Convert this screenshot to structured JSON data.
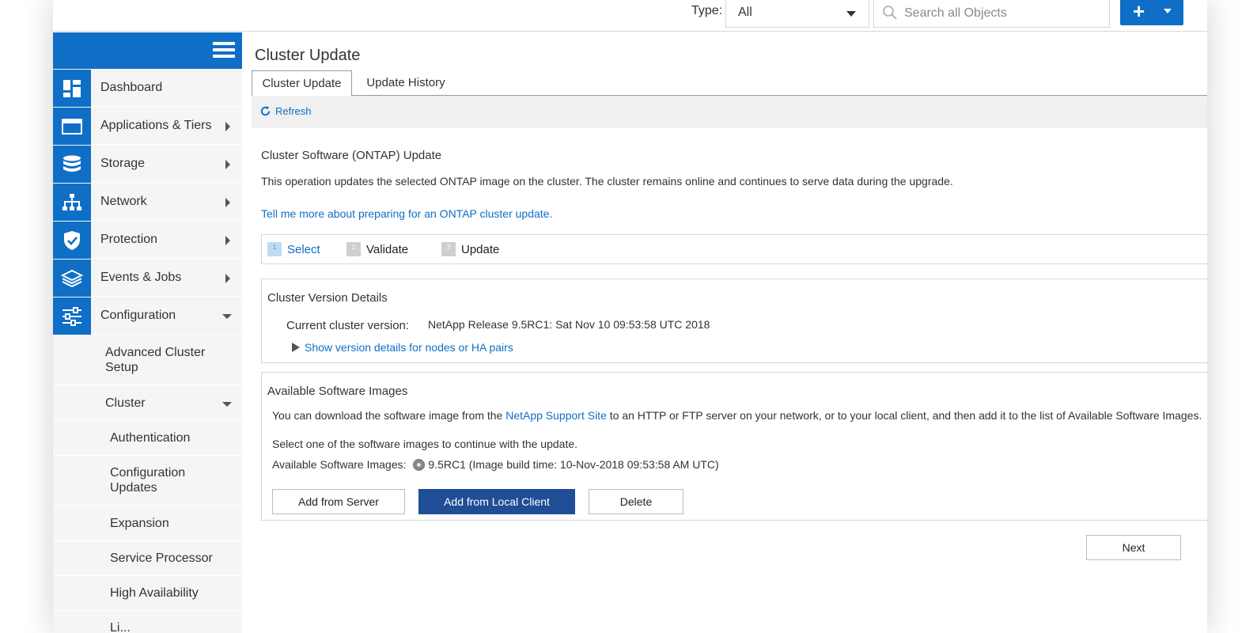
{
  "topbar": {
    "type_label": "Type:",
    "type_value": "All",
    "search_placeholder": "Search all Objects",
    "add_label": "+"
  },
  "sidebar": {
    "items": [
      {
        "label": "Dashboard",
        "icon": "dashboard-icon",
        "arrow": "none"
      },
      {
        "label": "Applications & Tiers",
        "icon": "applications-icon",
        "arrow": "right"
      },
      {
        "label": "Storage",
        "icon": "storage-icon",
        "arrow": "right"
      },
      {
        "label": "Network",
        "icon": "network-icon",
        "arrow": "right"
      },
      {
        "label": "Protection",
        "icon": "shield-check-icon",
        "arrow": "right"
      },
      {
        "label": "Events & Jobs",
        "icon": "layers-icon",
        "arrow": "right"
      },
      {
        "label": "Configuration",
        "icon": "sliders-icon",
        "arrow": "down"
      }
    ],
    "sub_items": [
      {
        "label": "Advanced Cluster Setup"
      },
      {
        "label": "Cluster"
      },
      {
        "label": "Authentication"
      },
      {
        "label": "Configuration Updates"
      },
      {
        "label": "Expansion"
      },
      {
        "label": "Service Processor"
      },
      {
        "label": "High Availability"
      },
      {
        "label": "Li..."
      }
    ]
  },
  "main": {
    "title": "Cluster Update",
    "tabs": [
      {
        "label": "Cluster Update",
        "active": true
      },
      {
        "label": "Update History",
        "active": false
      }
    ],
    "refresh_label": "Refresh",
    "section_title": "Cluster Software (ONTAP) Update",
    "description": "This operation updates the selected ONTAP image on the cluster. The cluster remains online and continues to serve data during the upgrade.",
    "learn_more": "Tell me more about preparing for an ONTAP cluster update.",
    "steps": [
      {
        "num": "1",
        "label": "Select",
        "active": true
      },
      {
        "num": "2",
        "label": "Validate",
        "active": false
      },
      {
        "num": "3",
        "label": "Update",
        "active": false
      }
    ],
    "version_panel": {
      "title": "Cluster Version Details",
      "current_label": "Current cluster version:",
      "current_value": "NetApp Release 9.5RC1: Sat Nov 10 09:53:58 UTC 2018",
      "details_link": "Show version details for nodes or HA pairs"
    },
    "images_panel": {
      "title": "Available Software Images",
      "desc_before": "You can download the software image from the ",
      "desc_link": "NetApp Support Site",
      "desc_after": " to an HTTP or FTP server on your network, or to your local client, and then add it to the list of Available Software Images.",
      "select_text": "Select one of the software images to continue with the update.",
      "list_label": "Available Software Images:",
      "image_option": "9.5RC1 (Image build time: 10-Nov-2018 09:53:58 AM UTC)",
      "buttons": {
        "add_server": "Add from Server",
        "add_local": "Add from Local Client",
        "delete": "Delete"
      }
    },
    "next_label": "Next"
  },
  "colors": {
    "brand_blue": "#0f6fc6",
    "primary_button": "#1f4e96",
    "sidebar_bg": "#f5f5f5"
  }
}
